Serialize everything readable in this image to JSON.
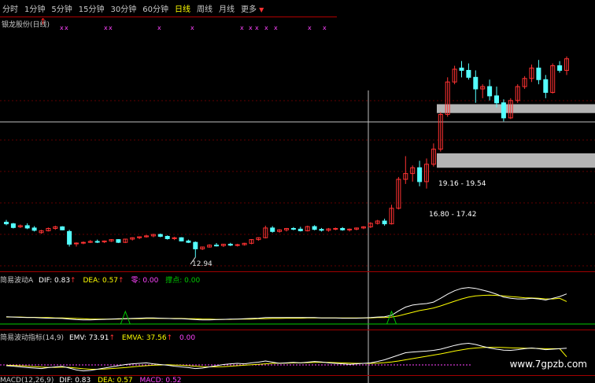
{
  "menu": {
    "tabs": [
      {
        "label": "分时",
        "active": false
      },
      {
        "label": "1分钟",
        "active": false
      },
      {
        "label": "5分钟",
        "active": false
      },
      {
        "label": "15分钟",
        "active": false
      },
      {
        "label": "30分钟",
        "active": false
      },
      {
        "label": "60分钟",
        "active": false
      },
      {
        "label": "日线",
        "active": true
      },
      {
        "label": "周线",
        "active": false
      },
      {
        "label": "月线",
        "active": false
      },
      {
        "label": "更多",
        "active": false
      }
    ],
    "more_icon": "chevron-down-icon"
  },
  "main_panel": {
    "title": "银龙股份(日线)",
    "signal_marker": "x",
    "low_label": "12.94",
    "zone_upper": "19.16 - 19.54",
    "zone_lower": "16.80 - 17.42"
  },
  "indicator_a": {
    "name": "简易波动A",
    "dif_label": "DIF: 0.83",
    "dea_label": "DEA: 0.57",
    "zero_label": "零: 0.00",
    "point_label": "撑点: 0.00"
  },
  "indicator_b": {
    "name": "简易波动指标(14,9)",
    "emv_label": "EMV: 73.91",
    "emva_label": "EMVA: 37.56",
    "extra_label": "0.00"
  },
  "indicator_c": {
    "name": "MACD(12,26,9)",
    "dif_label": "DIF: 0.83",
    "dea_label": "DEA: 0.57",
    "macd_label": "MACD: 0.52"
  },
  "watermark": "www.7gpzb.com",
  "colors": {
    "up": "#ff3232",
    "down": "#54ffff",
    "separator": "#a00000",
    "dif_line": "#ffffff",
    "dea_line": "#ffff00",
    "marker": "#ff44ff",
    "signal": "#00cc00",
    "zone": "#b4b4b4"
  },
  "chart_data": {
    "type": "candlestick",
    "candles": [
      [
        14.45,
        14.55,
        14.32,
        14.38
      ],
      [
        14.38,
        14.42,
        14.18,
        14.22
      ],
      [
        14.25,
        14.35,
        14.2,
        14.3
      ],
      [
        14.3,
        14.4,
        14.15,
        14.2
      ],
      [
        14.2,
        14.28,
        14.05,
        14.1
      ],
      [
        14.0,
        14.12,
        13.95,
        14.08
      ],
      [
        14.08,
        14.22,
        14.05,
        14.18
      ],
      [
        14.18,
        14.3,
        14.12,
        14.25
      ],
      [
        14.25,
        14.28,
        14.1,
        14.12
      ],
      [
        14.05,
        14.12,
        13.4,
        13.5
      ],
      [
        13.52,
        13.58,
        13.4,
        13.55
      ],
      [
        13.55,
        13.62,
        13.5,
        13.58
      ],
      [
        13.58,
        13.68,
        13.55,
        13.62
      ],
      [
        13.62,
        13.7,
        13.55,
        13.6
      ],
      [
        13.6,
        13.66,
        13.55,
        13.64
      ],
      [
        13.64,
        13.72,
        13.6,
        13.7
      ],
      [
        13.7,
        13.72,
        13.55,
        13.58
      ],
      [
        13.58,
        13.74,
        13.55,
        13.72
      ],
      [
        13.72,
        13.8,
        13.66,
        13.78
      ],
      [
        13.78,
        13.84,
        13.72,
        13.82
      ],
      [
        13.82,
        13.9,
        13.78,
        13.86
      ],
      [
        13.86,
        13.95,
        13.8,
        13.92
      ],
      [
        13.92,
        13.96,
        13.8,
        13.84
      ],
      [
        13.84,
        13.88,
        13.7,
        13.74
      ],
      [
        13.74,
        13.82,
        13.68,
        13.78
      ],
      [
        13.78,
        13.8,
        13.62,
        13.64
      ],
      [
        13.64,
        13.7,
        13.55,
        13.58
      ],
      [
        13.58,
        13.62,
        12.94,
        13.3
      ],
      [
        13.3,
        13.4,
        13.25,
        13.38
      ],
      [
        13.38,
        13.5,
        13.35,
        13.46
      ],
      [
        13.46,
        13.55,
        13.4,
        13.44
      ],
      [
        13.44,
        13.52,
        13.38,
        13.5
      ],
      [
        13.5,
        13.56,
        13.42,
        13.46
      ],
      [
        13.46,
        13.52,
        13.4,
        13.48
      ],
      [
        13.48,
        13.56,
        13.44,
        13.54
      ],
      [
        13.54,
        13.72,
        13.5,
        13.7
      ],
      [
        13.7,
        13.8,
        13.65,
        13.78
      ],
      [
        13.78,
        14.3,
        13.75,
        14.2
      ],
      [
        14.2,
        14.28,
        14.0,
        14.05
      ],
      [
        14.05,
        14.15,
        14.0,
        14.12
      ],
      [
        14.12,
        14.2,
        14.05,
        14.18
      ],
      [
        14.18,
        14.24,
        14.1,
        14.15
      ],
      [
        14.15,
        14.25,
        14.05,
        14.08
      ],
      [
        14.08,
        14.3,
        14.05,
        14.26
      ],
      [
        14.26,
        14.32,
        14.1,
        14.14
      ],
      [
        14.14,
        14.2,
        14.05,
        14.1
      ],
      [
        14.1,
        14.2,
        14.04,
        14.16
      ],
      [
        14.16,
        14.22,
        14.1,
        14.18
      ],
      [
        14.18,
        14.24,
        14.08,
        14.12
      ],
      [
        14.12,
        14.18,
        14.05,
        14.15
      ],
      [
        14.15,
        14.22,
        14.1,
        14.2
      ],
      [
        14.2,
        14.28,
        14.15,
        14.25
      ],
      [
        14.25,
        14.45,
        14.2,
        14.4
      ],
      [
        14.4,
        14.55,
        14.35,
        14.5
      ],
      [
        14.5,
        14.6,
        14.3,
        14.38
      ],
      [
        14.38,
        15.2,
        14.35,
        15.05
      ],
      [
        15.05,
        16.4,
        15.0,
        16.3
      ],
      [
        16.3,
        17.3,
        16.1,
        16.55
      ],
      [
        16.55,
        16.9,
        16.2,
        16.8
      ],
      [
        16.8,
        17.1,
        16.0,
        16.2
      ],
      [
        16.2,
        17.2,
        15.9,
        16.95
      ],
      [
        16.95,
        17.85,
        16.85,
        17.6
      ],
      [
        17.6,
        19.2,
        17.5,
        19.1
      ],
      [
        19.1,
        20.7,
        19.0,
        20.5
      ],
      [
        20.5,
        21.2,
        20.4,
        21.05
      ],
      [
        21.1,
        21.4,
        20.7,
        21.0
      ],
      [
        21.0,
        21.3,
        20.6,
        20.7
      ],
      [
        20.7,
        21.0,
        19.6,
        20.2
      ],
      [
        20.2,
        20.4,
        19.8,
        20.3
      ],
      [
        20.3,
        20.6,
        19.7,
        19.9
      ],
      [
        19.9,
        20.3,
        19.4,
        19.6
      ],
      [
        19.6,
        19.75,
        18.8,
        18.95
      ],
      [
        18.95,
        19.8,
        18.9,
        19.7
      ],
      [
        19.7,
        20.4,
        19.6,
        20.3
      ],
      [
        20.3,
        20.75,
        20.2,
        20.65
      ],
      [
        20.65,
        21.25,
        20.5,
        21.1
      ],
      [
        21.1,
        21.45,
        20.4,
        20.6
      ],
      [
        20.6,
        20.8,
        19.8,
        20.05
      ],
      [
        20.05,
        21.3,
        20.0,
        21.2
      ],
      [
        21.2,
        21.4,
        20.9,
        21.0
      ],
      [
        21.0,
        21.6,
        20.8,
        21.5
      ]
    ],
    "price_range": [
      12.5,
      22.0
    ],
    "low_annotation": 12.94,
    "zones": [
      {
        "label": "19.16 - 19.54",
        "low": 19.16,
        "high": 19.54
      },
      {
        "label": "16.80 - 17.42",
        "low": 16.8,
        "high": 17.42
      }
    ],
    "indicator_a": {
      "dif": [
        0.05,
        0.04,
        0.03,
        0.02,
        0.02,
        0.01,
        0.0,
        0.0,
        -0.01,
        -0.03,
        -0.05,
        -0.06,
        -0.06,
        -0.05,
        -0.04,
        -0.03,
        -0.02,
        -0.02,
        -0.01,
        0.0,
        0.01,
        0.01,
        0.0,
        -0.01,
        -0.02,
        -0.02,
        -0.03,
        -0.05,
        -0.06,
        -0.06,
        -0.05,
        -0.04,
        -0.03,
        -0.03,
        -0.02,
        -0.01,
        0.0,
        0.02,
        0.02,
        0.02,
        0.02,
        0.02,
        0.02,
        0.02,
        0.02,
        0.01,
        0.01,
        0.01,
        0.0,
        0.0,
        0.0,
        0.01,
        0.02,
        0.04,
        0.05,
        0.1,
        0.25,
        0.38,
        0.45,
        0.48,
        0.5,
        0.55,
        0.68,
        0.82,
        0.94,
        1.02,
        1.05,
        1.02,
        0.96,
        0.9,
        0.82,
        0.72,
        0.68,
        0.66,
        0.66,
        0.68,
        0.66,
        0.62,
        0.68,
        0.74,
        0.83
      ],
      "dea": [
        0.04,
        0.04,
        0.04,
        0.03,
        0.03,
        0.02,
        0.02,
        0.01,
        0.01,
        0.0,
        -0.01,
        -0.02,
        -0.03,
        -0.03,
        -0.03,
        -0.03,
        -0.03,
        -0.02,
        -0.02,
        -0.02,
        -0.01,
        -0.01,
        -0.01,
        -0.01,
        -0.01,
        -0.01,
        -0.02,
        -0.02,
        -0.03,
        -0.03,
        -0.04,
        -0.04,
        -0.04,
        -0.03,
        -0.03,
        -0.03,
        -0.02,
        -0.02,
        -0.01,
        -0.01,
        0.0,
        0.0,
        0.0,
        0.01,
        0.01,
        0.01,
        0.01,
        0.01,
        0.01,
        0.01,
        0.01,
        0.01,
        0.01,
        0.02,
        0.02,
        0.04,
        0.08,
        0.14,
        0.2,
        0.26,
        0.3,
        0.35,
        0.42,
        0.5,
        0.58,
        0.66,
        0.72,
        0.76,
        0.78,
        0.79,
        0.78,
        0.76,
        0.74,
        0.72,
        0.7,
        0.69,
        0.68,
        0.66,
        0.66,
        0.68,
        0.57
      ],
      "signals": [
        17,
        55
      ],
      "range": [
        -0.2,
        1.2
      ]
    },
    "indicator_b": {
      "emv": [
        0,
        -2,
        -5,
        -8,
        -10,
        -12,
        -8,
        -5,
        -3,
        -10,
        -18,
        -22,
        -20,
        -15,
        -10,
        -5,
        0,
        5,
        8,
        10,
        12,
        8,
        5,
        2,
        -2,
        -5,
        -8,
        -12,
        -10,
        -5,
        0,
        5,
        8,
        10,
        8,
        12,
        15,
        20,
        15,
        10,
        12,
        14,
        12,
        15,
        18,
        16,
        12,
        10,
        8,
        6,
        8,
        10,
        12,
        18,
        25,
        35,
        45,
        55,
        58,
        60,
        62,
        65,
        70,
        78,
        86,
        92,
        95,
        90,
        82,
        75,
        70,
        66,
        65,
        68,
        72,
        75,
        72,
        68,
        70,
        72,
        73.91
      ],
      "emva": [
        2,
        1,
        0,
        -2,
        -4,
        -6,
        -7,
        -7,
        -6,
        -7,
        -10,
        -13,
        -15,
        -15,
        -14,
        -12,
        -10,
        -8,
        -5,
        -2,
        0,
        2,
        3,
        4,
        3,
        2,
        0,
        -2,
        -4,
        -5,
        -5,
        -4,
        -2,
        0,
        2,
        4,
        6,
        8,
        10,
        11,
        11,
        12,
        12,
        13,
        14,
        14,
        14,
        13,
        12,
        11,
        10,
        10,
        10,
        11,
        13,
        16,
        20,
        25,
        30,
        35,
        40,
        45,
        50,
        56,
        62,
        67,
        72,
        75,
        77,
        78,
        78,
        77,
        76,
        75,
        74,
        74,
        73,
        72,
        72,
        72,
        37.56
      ],
      "range": [
        -30,
        110
      ]
    }
  }
}
